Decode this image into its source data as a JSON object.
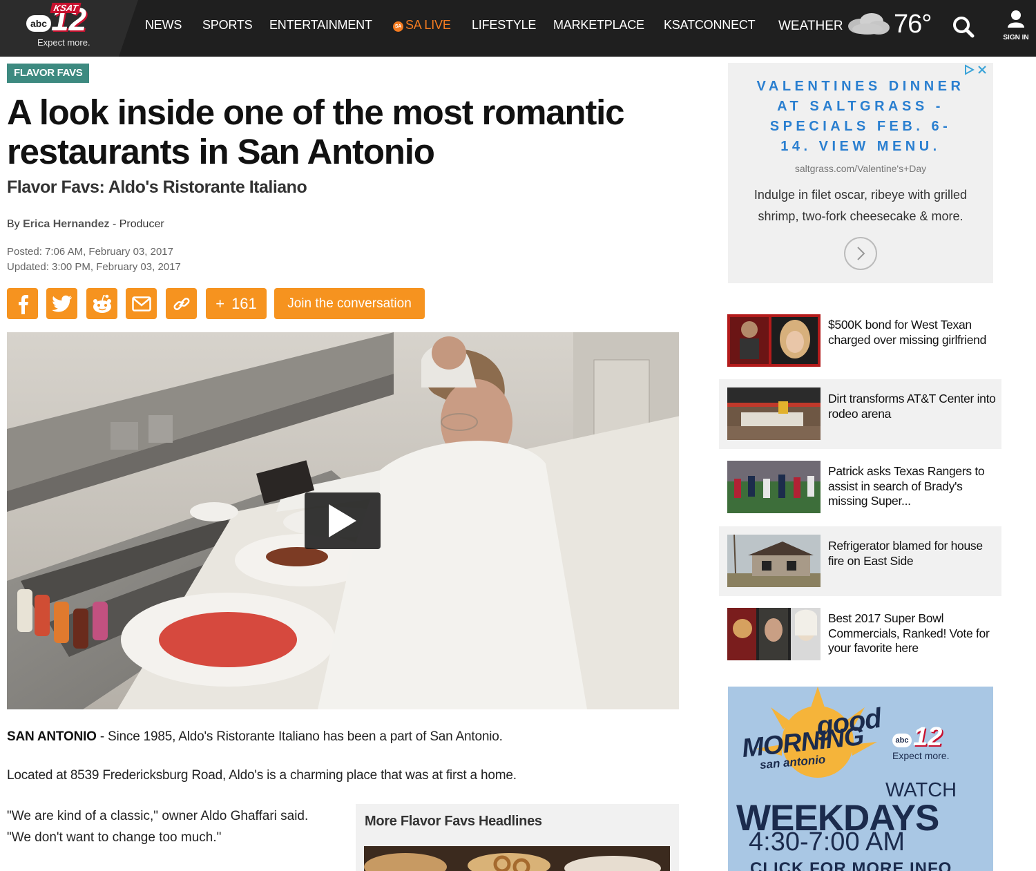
{
  "header": {
    "logo": {
      "brand": "KSAT",
      "network": "abc",
      "channel": "12",
      "tagline": "Expect more."
    },
    "nav": [
      {
        "label": "NEWS"
      },
      {
        "label": "SPORTS"
      },
      {
        "label": "ENTERTAINMENT"
      },
      {
        "label": "SA LIVE",
        "badge": "SA"
      },
      {
        "label": "LIFESTYLE"
      },
      {
        "label": "MARKETPLACE"
      },
      {
        "label": "KSATCONNECT"
      }
    ],
    "weather": {
      "label": "WEATHER",
      "temperature": "76°",
      "icon": "cloud-icon"
    },
    "search_icon": "search-icon",
    "signin_label": "SIGN IN"
  },
  "article": {
    "category": "FLAVOR FAVS",
    "headline": "A look inside one of the most romantic restaurants in San Antonio",
    "subhead": "Flavor Favs: Aldo's Ristorante Italiano",
    "byline": {
      "prefix": "By",
      "author": "Erica Hernandez",
      "role": "- Producer"
    },
    "posted": "Posted: 7:06 AM, February 03, 2017",
    "updated": "Updated: 3:00 PM, February 03, 2017",
    "share": {
      "icons": [
        "facebook-icon",
        "twitter-icon",
        "reddit-icon",
        "email-icon",
        "link-icon"
      ],
      "count_prefix": "+",
      "count": "161",
      "join_label": "Join the conversation"
    },
    "video": {
      "play_icon": "play-icon"
    },
    "dateline": "SAN ANTONIO",
    "p1": " - Since 1985, Aldo's Ristorante Italiano has been a part of San Antonio.",
    "p2": "Located at 8539 Fredericksburg Road, Aldo's is a charming place that was at first a home.",
    "quote_line1": "\"We are kind of a classic,\" owner Aldo Ghaffari said.",
    "quote_line2": "\"We don't want to change too much.\"",
    "more_headlines_title": "More Flavor Favs Headlines"
  },
  "sidebar": {
    "ad_top": {
      "headline": "VALENTINES DINNER AT SALTGRASS - SPECIALS FEB. 6-14. VIEW MENU.",
      "url": "saltgrass.com/Valentine's+Day",
      "body": "Indulge in filet oscar, ribeye with grilled shrimp, two-fork cheesecake & more."
    },
    "stories": [
      {
        "title": "$500K bond for West Texan charged over missing girlfriend"
      },
      {
        "title": "Dirt transforms AT&T Center into rodeo arena"
      },
      {
        "title": "Patrick asks Texas Rangers to assist in search of Brady's missing Super..."
      },
      {
        "title": "Refrigerator blamed for house fire on East Side"
      },
      {
        "title": "Best 2017 Super Bowl Commercials, Ranked! Vote for your favorite here"
      }
    ],
    "ad_bottom": {
      "good": "good",
      "morning": "MORNING",
      "city": "san antonio",
      "station_tagline": "Expect more.",
      "watch": "WATCH",
      "weekdays": "WEEKDAYS",
      "time": "4:30-7:00 AM",
      "cta": "CLICK FOR MORE INFO"
    }
  },
  "colors": {
    "header_bg": "#1f1f1f",
    "accent_orange": "#f6931f",
    "category_teal": "#3d8a80",
    "ad_blue": "#2a7fd0"
  }
}
